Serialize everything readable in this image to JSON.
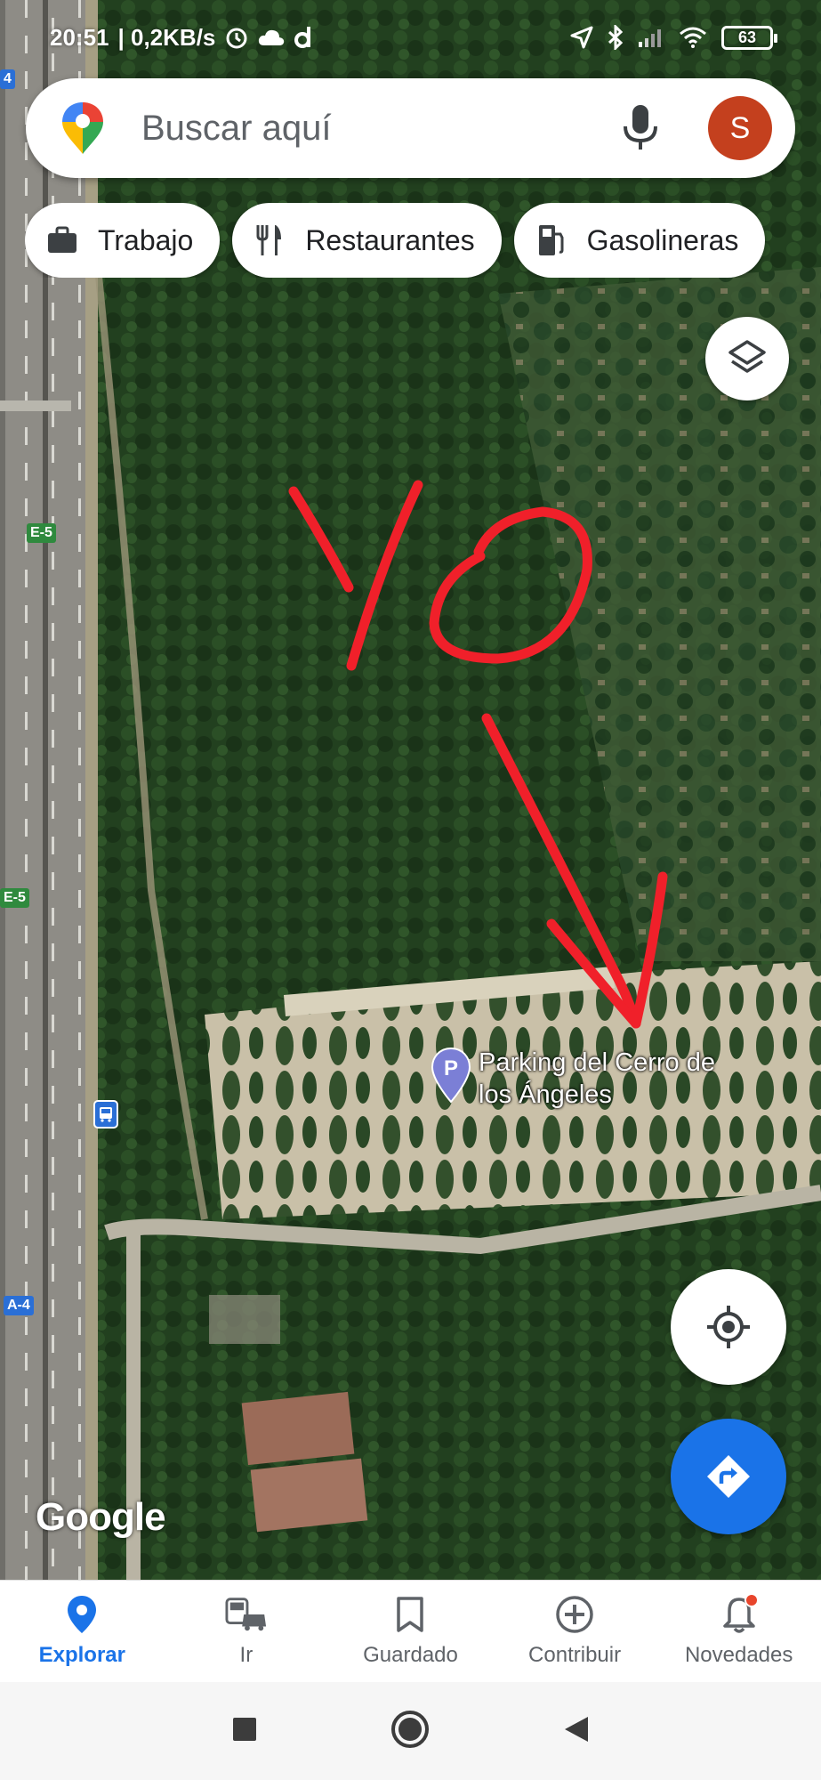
{
  "status_bar": {
    "time": "20:51",
    "network_speed": "| 0,2KB/s",
    "battery": "63"
  },
  "search": {
    "placeholder": "Buscar aquí",
    "avatar_letter": "S"
  },
  "chips": [
    {
      "label": "Trabajo",
      "icon": "briefcase-icon"
    },
    {
      "label": "Restaurantes",
      "icon": "fork-knife-icon"
    },
    {
      "label": "Gasolineras",
      "icon": "gas-station-icon"
    }
  ],
  "map": {
    "place_name": "Parking del Cerro de los Ángeles",
    "attribution": "Google",
    "road_shields": [
      "E-5",
      "E-5",
      "A-4",
      "4"
    ],
    "annotation": {
      "text": "YO",
      "color": "#f0202a"
    }
  },
  "bottom_nav": [
    {
      "label": "Explorar",
      "icon": "explore-pin-icon",
      "active": true
    },
    {
      "label": "Ir",
      "icon": "commute-icon",
      "active": false
    },
    {
      "label": "Guardado",
      "icon": "bookmark-icon",
      "active": false
    },
    {
      "label": "Contribuir",
      "icon": "add-circle-icon",
      "active": false
    },
    {
      "label": "Novedades",
      "icon": "bell-icon",
      "active": false
    }
  ],
  "colors": {
    "accent": "#1a73e8",
    "avatar": "#c4401e",
    "annotation_red": "#f0202a"
  }
}
